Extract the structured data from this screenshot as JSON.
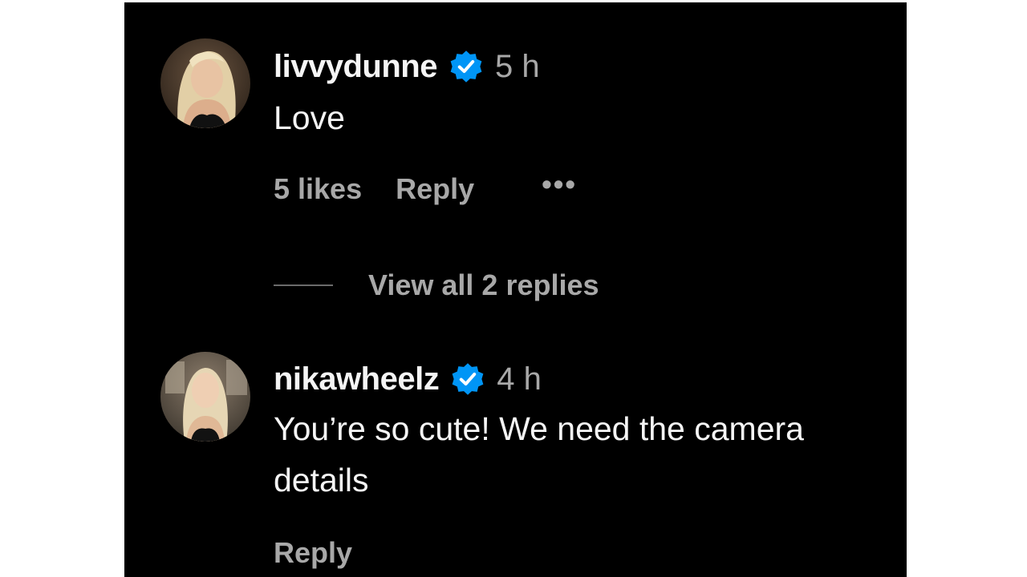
{
  "comments": [
    {
      "username": "livvydunne",
      "verified": true,
      "time": "5 h",
      "text": "Love",
      "likes": "5 likes",
      "reply_label": "Reply",
      "more_label": "•••",
      "view_replies": "View all 2 replies",
      "avatar_icon": "profile-photo-icon"
    },
    {
      "username": "nikawheelz",
      "verified": true,
      "time": "4 h",
      "text": "You’re so cute! We need the camera details",
      "reply_label": "Reply",
      "avatar_icon": "profile-photo-icon"
    }
  ],
  "colors": {
    "background": "#000000",
    "primary_text": "#f5f5f5",
    "secondary_text": "#a8a8a8",
    "verified_badge": "#0095f6"
  }
}
